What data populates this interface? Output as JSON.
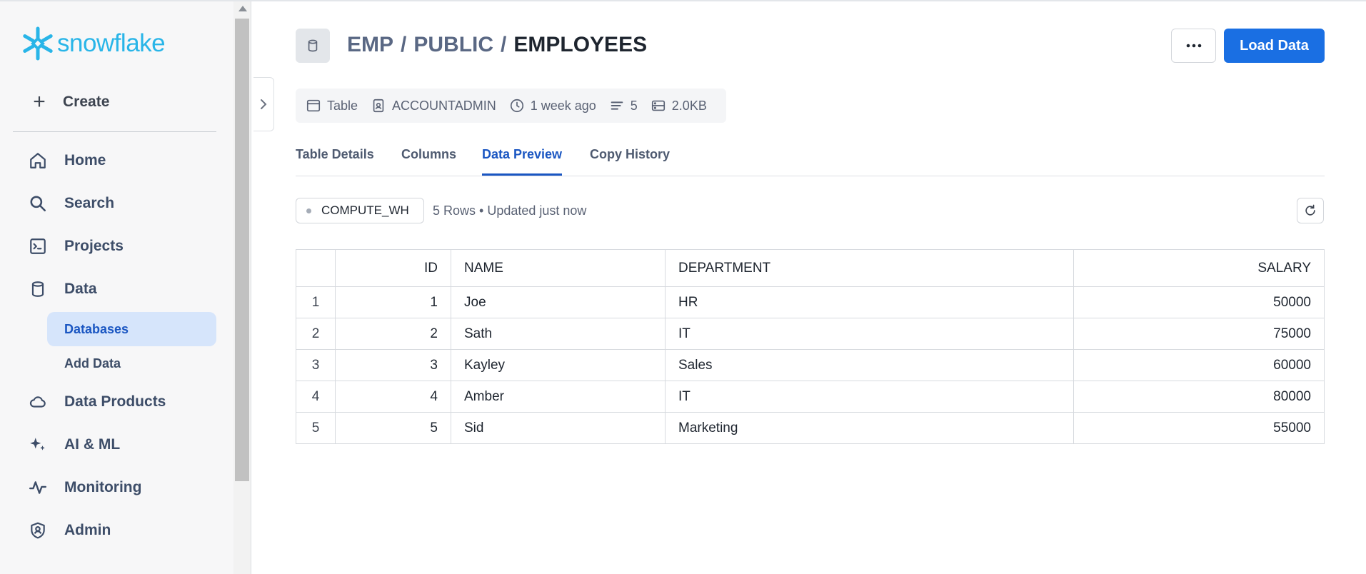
{
  "app": {
    "logo_text": "snowflake",
    "brand_color": "#29b5e8"
  },
  "sidebar": {
    "create_label": "Create",
    "items": [
      {
        "label": "Home",
        "icon": "home-icon"
      },
      {
        "label": "Search",
        "icon": "search-icon"
      },
      {
        "label": "Projects",
        "icon": "terminal-icon"
      },
      {
        "label": "Data",
        "icon": "database-icon"
      },
      {
        "label": "Data Products",
        "icon": "cloud-icon"
      },
      {
        "label": "AI & ML",
        "icon": "sparkle-icon"
      },
      {
        "label": "Monitoring",
        "icon": "activity-icon"
      },
      {
        "label": "Admin",
        "icon": "shield-icon"
      }
    ],
    "sub_items": [
      {
        "label": "Databases",
        "active": true
      },
      {
        "label": "Add Data",
        "active": false
      }
    ]
  },
  "header": {
    "breadcrumb": [
      "EMP",
      "PUBLIC",
      "EMPLOYEES"
    ],
    "separator": "/",
    "load_button": "Load Data"
  },
  "meta": {
    "type": "Table",
    "owner": "ACCOUNTADMIN",
    "modified": "1 week ago",
    "rows": "5",
    "size": "2.0KB"
  },
  "tabs": [
    {
      "label": "Table Details",
      "active": false
    },
    {
      "label": "Columns",
      "active": false
    },
    {
      "label": "Data Preview",
      "active": true
    },
    {
      "label": "Copy History",
      "active": false
    }
  ],
  "preview": {
    "warehouse": "COMPUTE_WH",
    "status": "5 Rows • Updated just now"
  },
  "table": {
    "columns": [
      "ID",
      "NAME",
      "DEPARTMENT",
      "SALARY"
    ],
    "rows": [
      {
        "row": "1",
        "id": "1",
        "name": "Joe",
        "department": "HR",
        "salary": "50000"
      },
      {
        "row": "2",
        "id": "2",
        "name": "Sath",
        "department": "IT",
        "salary": "75000"
      },
      {
        "row": "3",
        "id": "3",
        "name": "Kayley",
        "department": "Sales",
        "salary": "60000"
      },
      {
        "row": "4",
        "id": "4",
        "name": "Amber",
        "department": "IT",
        "salary": "80000"
      },
      {
        "row": "5",
        "id": "5",
        "name": "Sid",
        "department": "Marketing",
        "salary": "55000"
      }
    ]
  },
  "colors": {
    "accent": "#1a6fe3",
    "active_tab": "#1a56c2",
    "active_nav_bg": "#d6e5fb"
  }
}
